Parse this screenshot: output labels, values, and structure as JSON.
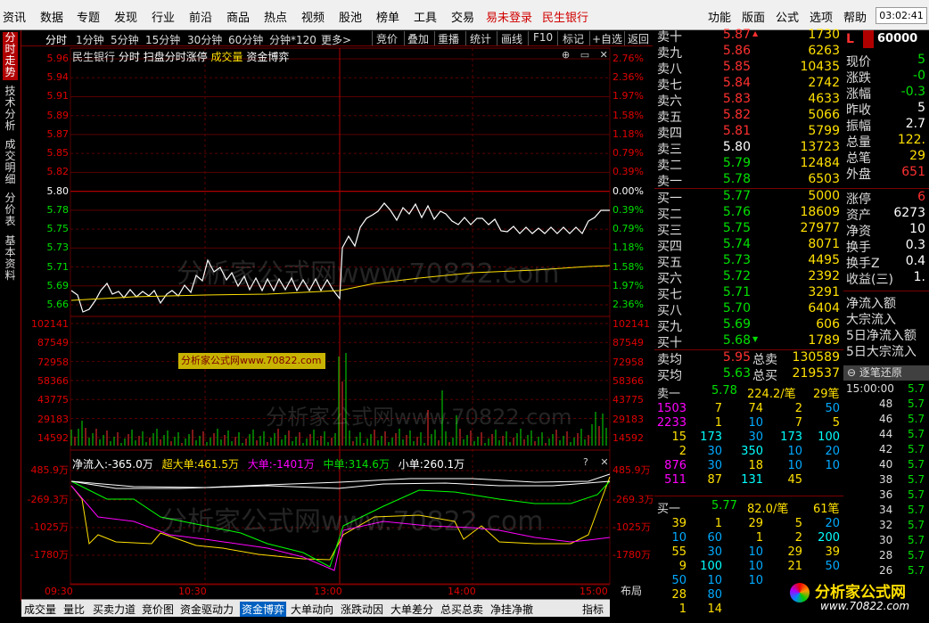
{
  "menu": {
    "items": [
      "资讯",
      "数据",
      "专题",
      "发现",
      "行业",
      "前沿",
      "商品",
      "热点",
      "视频",
      "股池",
      "榜单",
      "工具",
      "交易"
    ],
    "right_items": [
      "功能",
      "版面",
      "公式",
      "选项",
      "帮助"
    ],
    "login": "易未登录",
    "stock_name": "民生银行",
    "clock": "03:02:41"
  },
  "left_tabs": [
    "分时走势",
    "技术分析",
    "成交明细",
    "分价表",
    "基本资料"
  ],
  "period_tabs": [
    "分时",
    "1分钟",
    "5分钟",
    "15分钟",
    "30分钟",
    "60分钟",
    "分钟*120",
    "更多>"
  ],
  "tool_buttons": [
    "竞价",
    "叠加",
    "重播",
    "统计",
    "画线",
    "F10",
    "标记",
    "+自选",
    "返回"
  ],
  "chart_title": {
    "stock": "民生银行",
    "mode": "分时",
    "s1": "扫盘分时涨停",
    "s2": "成交量",
    "s3": "资金博弈"
  },
  "price_axis": {
    "left": [
      "5.96",
      "5.94",
      "5.91",
      "5.89",
      "5.87",
      "5.85",
      "5.82",
      "5.80",
      "5.78",
      "5.75",
      "5.73",
      "5.71",
      "5.69",
      "5.66"
    ],
    "right": [
      "2.76%",
      "2.36%",
      "1.97%",
      "1.58%",
      "1.18%",
      "0.79%",
      "0.39%",
      "0.00%",
      "0.39%",
      "0.79%",
      "1.18%",
      "1.58%",
      "1.97%",
      "2.36%"
    ]
  },
  "volume_axis": [
    "102141",
    "87549",
    "72958",
    "58366",
    "43775",
    "29183",
    "14592"
  ],
  "flow_title": {
    "net": "净流入:-365.0万",
    "xl": "超大单:461.5万",
    "l": "大单:-1401万",
    "m": "中单:314.6万",
    "s": "小单:260.1万"
  },
  "flow_axis": [
    "485.9万",
    "-269.3万",
    "-1025万",
    "-1780万"
  ],
  "time_axis": [
    "09:30",
    "10:30",
    "13:00",
    "14:00",
    "15:00"
  ],
  "watermark": {
    "main": "分析家公式网www.70822.com",
    "box": "分析家公式网www.70822.com"
  },
  "bottom_tabs": [
    "成交量",
    "量比",
    "买卖力道",
    "竞价图",
    "资金驱动力",
    "资金博弈",
    "大单动向",
    "涨跌动因",
    "大单差分",
    "总买总卖",
    "净挂净撤",
    "指标"
  ],
  "layout_label": "布局",
  "order_book": {
    "sells": [
      {
        "name": "卖十",
        "price": "5.87",
        "vol": "1730",
        "color": "#ff3030",
        "mark": "▲"
      },
      {
        "name": "卖九",
        "price": "5.86",
        "vol": "6263",
        "color": "#ff3030"
      },
      {
        "name": "卖八",
        "price": "5.85",
        "vol": "10435",
        "color": "#ff3030"
      },
      {
        "name": "卖七",
        "price": "5.84",
        "vol": "2742",
        "color": "#ff3030"
      },
      {
        "name": "卖六",
        "price": "5.83",
        "vol": "4633",
        "color": "#ff3030"
      },
      {
        "name": "卖五",
        "price": "5.82",
        "vol": "5066",
        "color": "#ff3030"
      },
      {
        "name": "卖四",
        "price": "5.81",
        "vol": "5799",
        "color": "#ff3030"
      },
      {
        "name": "卖三",
        "price": "5.80",
        "vol": "13723",
        "color": "#ffffff"
      },
      {
        "name": "卖二",
        "price": "5.79",
        "vol": "12484",
        "color": "#00e000"
      },
      {
        "name": "卖一",
        "price": "5.78",
        "vol": "6503",
        "color": "#00e000"
      }
    ],
    "buys": [
      {
        "name": "买一",
        "price": "5.77",
        "vol": "5000",
        "color": "#00e000"
      },
      {
        "name": "买二",
        "price": "5.76",
        "vol": "18609",
        "color": "#00e000"
      },
      {
        "name": "买三",
        "price": "5.75",
        "vol": "27977",
        "color": "#00e000"
      },
      {
        "name": "买四",
        "price": "5.74",
        "vol": "8071",
        "color": "#00e000"
      },
      {
        "name": "买五",
        "price": "5.73",
        "vol": "4495",
        "color": "#00e000"
      },
      {
        "name": "买六",
        "price": "5.72",
        "vol": "2392",
        "color": "#00e000"
      },
      {
        "name": "买七",
        "price": "5.71",
        "vol": "3291",
        "color": "#00e000"
      },
      {
        "name": "买八",
        "price": "5.70",
        "vol": "6404",
        "color": "#00e000"
      },
      {
        "name": "买九",
        "price": "5.69",
        "vol": "606",
        "color": "#00e000"
      },
      {
        "name": "买十",
        "price": "5.68",
        "vol": "1789",
        "color": "#00e000",
        "mark": "▼"
      }
    ],
    "avg": [
      {
        "name": "卖均",
        "price": "5.95",
        "label": "总卖",
        "vol": "130589",
        "color": "#ff3030"
      },
      {
        "name": "买均",
        "price": "5.63",
        "label": "总买",
        "vol": "219537",
        "color": "#00e000"
      }
    ]
  },
  "info_panel": {
    "code": "60000",
    "market": "L",
    "rows1": [
      {
        "label": "现价",
        "value": "5",
        "color": "#00e000"
      },
      {
        "label": "涨跌",
        "value": "-0",
        "color": "#00e000"
      },
      {
        "label": "涨幅",
        "value": "-0.3",
        "color": "#00e000"
      },
      {
        "label": "昨收",
        "value": "5",
        "color": "#ffffff"
      },
      {
        "label": "振幅",
        "value": "2.7",
        "color": "#ffffff"
      },
      {
        "label": "总量",
        "value": "122.",
        "color": "#ffe000"
      },
      {
        "label": "总笔",
        "value": "29",
        "color": "#ffe000"
      },
      {
        "label": "外盘",
        "value": "651",
        "color": "#ff3030"
      }
    ],
    "rows2": [
      {
        "label": "涨停",
        "value": "6",
        "color": "#ff3030"
      },
      {
        "label": "资产",
        "value": "6273",
        "color": "#ffffff"
      },
      {
        "label": "净资",
        "value": "10",
        "color": "#ffffff"
      },
      {
        "label": "换手",
        "value": "0.3",
        "color": "#ffffff"
      },
      {
        "label": "换手Z",
        "value": "0.4",
        "color": "#ffffff"
      },
      {
        "label": "收益(三)",
        "value": "1.",
        "color": "#ffffff"
      }
    ],
    "flows": [
      "净流入额",
      "大宗流入",
      "5日净流入额",
      "5日大宗流入"
    ],
    "tick_title": "逐笔还原",
    "tick_time": "15:00:00",
    "tick_values": [
      "5.7",
      "5.7",
      "5.7",
      "5.7",
      "5.7",
      "5.7",
      "5.7",
      "5.7",
      "5.7",
      "5.7",
      "5.7",
      "5.7",
      "5.7"
    ]
  },
  "trades": {
    "sell_head": {
      "label": "卖一",
      "price": "5.78",
      "amount": "224.2/笔",
      "count": "29笔"
    },
    "sell_rows": [
      [
        "1503",
        "7",
        "74",
        "2",
        "50"
      ],
      [
        "2233",
        "1",
        "10",
        "7",
        "5"
      ],
      [
        "15",
        "173",
        "30",
        "173",
        "100"
      ],
      [
        "2",
        "30",
        "350",
        "10",
        "20"
      ],
      [
        "876",
        "30",
        "18",
        "10",
        "10"
      ],
      [
        "511",
        "87",
        "131",
        "45",
        ""
      ]
    ],
    "buy_head": {
      "label": "买一",
      "price": "5.77",
      "amount": "82.0/笔",
      "count": "61笔"
    },
    "buy_rows": [
      [
        "39",
        "1",
        "29",
        "5",
        "20"
      ],
      [
        "10",
        "60",
        "1",
        "2",
        "200"
      ],
      [
        "55",
        "30",
        "10",
        "29",
        "39"
      ],
      [
        "9",
        "100",
        "10",
        "21",
        "50"
      ],
      [
        "50",
        "10",
        "10",
        "",
        ""
      ],
      [
        "28",
        "80",
        "",
        "",
        ""
      ],
      [
        "1",
        "14",
        "",
        "",
        ""
      ]
    ]
  },
  "logo": {
    "name": "分析家公式网",
    "url": "www.70822.com"
  },
  "colors": {
    "up": "#ff3030",
    "down": "#00e000",
    "grid": "#7a0000",
    "price_line": "#ffffff",
    "avg_line": "#ffe000",
    "volume": "#00e000",
    "flow_net": "#ffffff",
    "flow_xl": "#ffe000",
    "flow_l": "#ff00ff",
    "flow_m": "#00ff00",
    "flow_s": "#ffffff"
  }
}
